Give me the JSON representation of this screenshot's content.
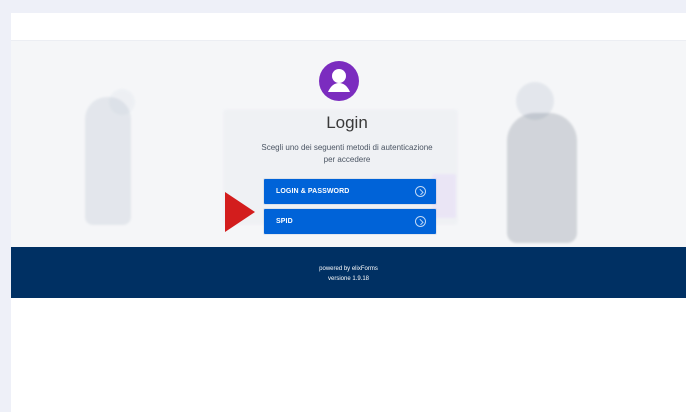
{
  "login": {
    "title": "Login",
    "helper_line_1": "Scegli uno dei seguenti metodi di autenticazione",
    "helper_line_2": "per accedere",
    "options": [
      {
        "label": "LOGIN & PASSWORD",
        "icon": "arrow-right-circle-icon"
      },
      {
        "label": "SPID",
        "icon": "arrow-right-circle-icon"
      }
    ]
  },
  "footer": {
    "powered_by": "powered by elixForms",
    "version": "versione 1.9.18"
  },
  "colors": {
    "page_background": "#eef0f8",
    "hero_background": "#f5f6f8",
    "button_blue": "#0063d8",
    "footer_blue": "#003063",
    "avatar_purple": "#7b2cbf",
    "pointer_red": "#d31d1d"
  }
}
